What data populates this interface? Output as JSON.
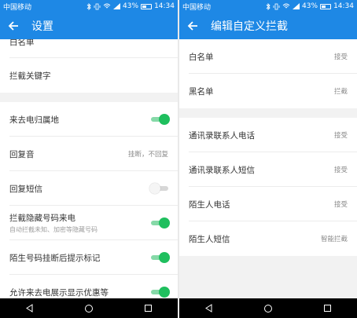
{
  "colors": {
    "primary": "#1e88e5",
    "toggle_on": "#1fbf5e",
    "nav_bar": "#000000"
  },
  "status_bar": {
    "carrier": "中国移动",
    "battery": "43%",
    "time": "14:34"
  },
  "left": {
    "title": "设置",
    "items": [
      {
        "label": "白名单"
      },
      {
        "label": "拦截关键字"
      },
      {
        "label": "来去电归属地",
        "toggle": "on"
      },
      {
        "label": "回复音",
        "value": "挂断，不回复"
      },
      {
        "label": "回复短信",
        "toggle": "off"
      },
      {
        "label": "拦截隐藏号码来电",
        "sub": "自动拦截未知、加密等隐藏号码",
        "toggle": "on"
      },
      {
        "label": "陌生号码挂断后提示标记",
        "toggle": "on"
      },
      {
        "label": "允许来去电展示显示优惠等",
        "toggle": "on"
      }
    ]
  },
  "right": {
    "title": "编辑自定义拦截",
    "items": [
      {
        "label": "白名单",
        "value": "接受"
      },
      {
        "label": "黑名单",
        "value": "拦截"
      },
      {
        "label": "通讯录联系人电话",
        "value": "接受"
      },
      {
        "label": "通讯录联系人短信",
        "value": "接受"
      },
      {
        "label": "陌生人电话",
        "value": "接受"
      },
      {
        "label": "陌生人短信",
        "value": "智能拦截"
      }
    ]
  },
  "icons": {
    "back": "arrow-left-icon",
    "nav": [
      "back-triangle-icon",
      "home-circle-icon",
      "recents-square-icon"
    ],
    "status": [
      "bluetooth-icon",
      "vibrate-icon",
      "wifi-icon",
      "signal-icon",
      "battery-icon"
    ]
  }
}
